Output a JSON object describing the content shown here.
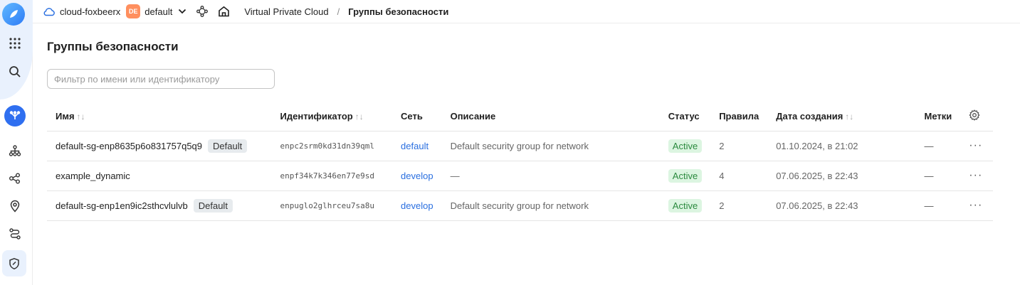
{
  "topbar": {
    "cloud_name": "cloud-foxbeerx",
    "folder_badge": "DE",
    "folder_name": "default",
    "breadcrumb": "Virtual Private Cloud",
    "separator": "/",
    "current": "Группы безопасности"
  },
  "page": {
    "title": "Группы безопасности",
    "filter_placeholder": "Фильтр по имени или идентификатору"
  },
  "table": {
    "columns": {
      "name": "Имя",
      "id": "Идентификатор",
      "network": "Сеть",
      "description": "Описание",
      "status": "Статус",
      "rules": "Правила",
      "created": "Дата создания",
      "labels": "Метки"
    },
    "sort_glyph": "↑↓",
    "rows": [
      {
        "name": "default-sg-enp8635p6o831757q5q9",
        "tag": "Default",
        "id": "enpc2srm0kd31dn39qml",
        "network": "default",
        "description": "Default security group for network",
        "status": "Active",
        "rules": "2",
        "created": "01.10.2024, в 21:02",
        "labels": "—",
        "more": "···"
      },
      {
        "name": "example_dynamic",
        "tag": "",
        "id": "enpf34k7k346en77e9sd",
        "network": "develop",
        "description": "—",
        "status": "Active",
        "rules": "4",
        "created": "07.06.2025, в 22:43",
        "labels": "—",
        "more": "···"
      },
      {
        "name": "default-sg-enp1en9ic2sthcvlulvb",
        "tag": "Default",
        "id": "enpuglo2glhrceu7sa8u",
        "network": "develop",
        "description": "Default security group for network",
        "status": "Active",
        "rules": "2",
        "created": "07.06.2025, в 22:43",
        "labels": "—",
        "more": "···"
      }
    ]
  },
  "colors": {
    "accent": "#2f6ff0",
    "link": "#2a6fe0",
    "status_bg": "#dcf5e1",
    "status_text": "#2b8a3e",
    "folder_badge": "#ff8f5e"
  },
  "icons": {
    "sidebar": [
      "logo-icon",
      "apps-grid-icon",
      "search-icon",
      "vpc-service-icon",
      "network-topology-icon",
      "connections-icon",
      "location-pin-icon",
      "route-icon",
      "shield-icon"
    ],
    "topbar": [
      "cloud-icon",
      "chevron-down-icon",
      "nodes-icon",
      "home-icon"
    ],
    "table": [
      "settings-gear-icon"
    ]
  }
}
